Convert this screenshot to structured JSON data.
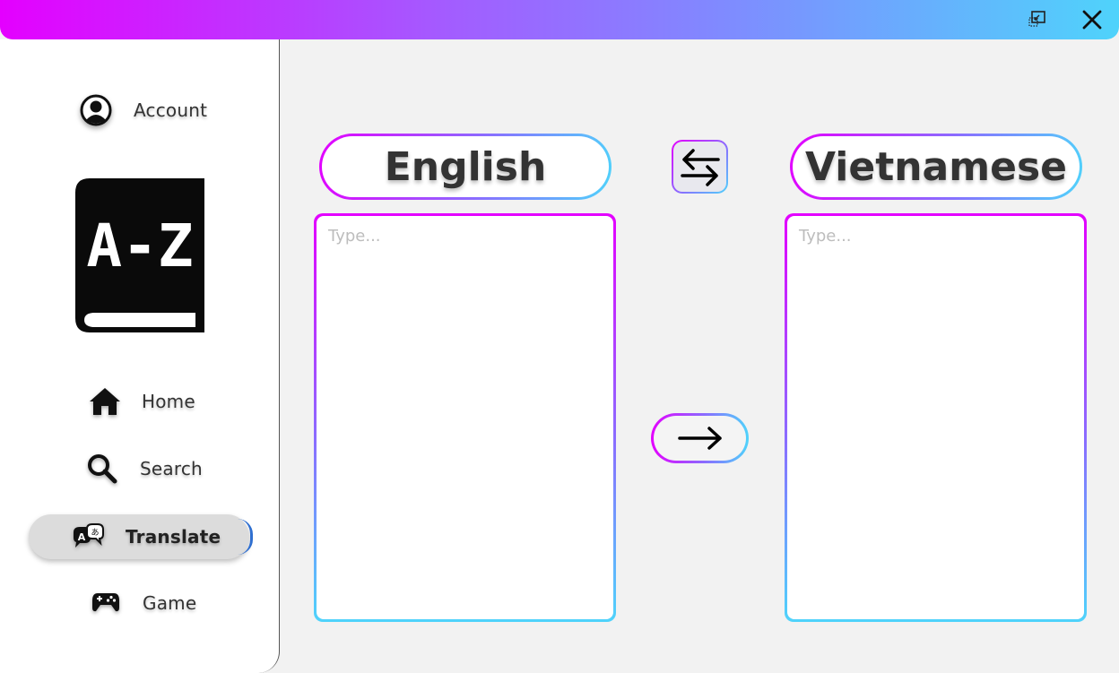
{
  "window": {
    "restore_icon": "restore-window-icon",
    "close_icon": "close-icon"
  },
  "sidebar": {
    "account_label": "Account",
    "logo_text": "A-Z",
    "items": [
      {
        "label": "Home",
        "icon": "home-icon"
      },
      {
        "label": "Search",
        "icon": "search-icon"
      },
      {
        "label": "Translate",
        "icon": "translate-icon",
        "active": true
      },
      {
        "label": "Game",
        "icon": "gamepad-icon"
      }
    ]
  },
  "translator": {
    "source_language": "English",
    "target_language": "Vietnamese",
    "source_placeholder": "Type...",
    "target_placeholder": "Type...",
    "swap_icon": "swap-arrows-icon",
    "translate_icon": "arrow-right-icon"
  },
  "colors": {
    "gradient_start": "#e400ff",
    "gradient_mid": "#8a6cff",
    "gradient_end": "#4fd3fb",
    "active_indicator": "#2f6fd0"
  }
}
